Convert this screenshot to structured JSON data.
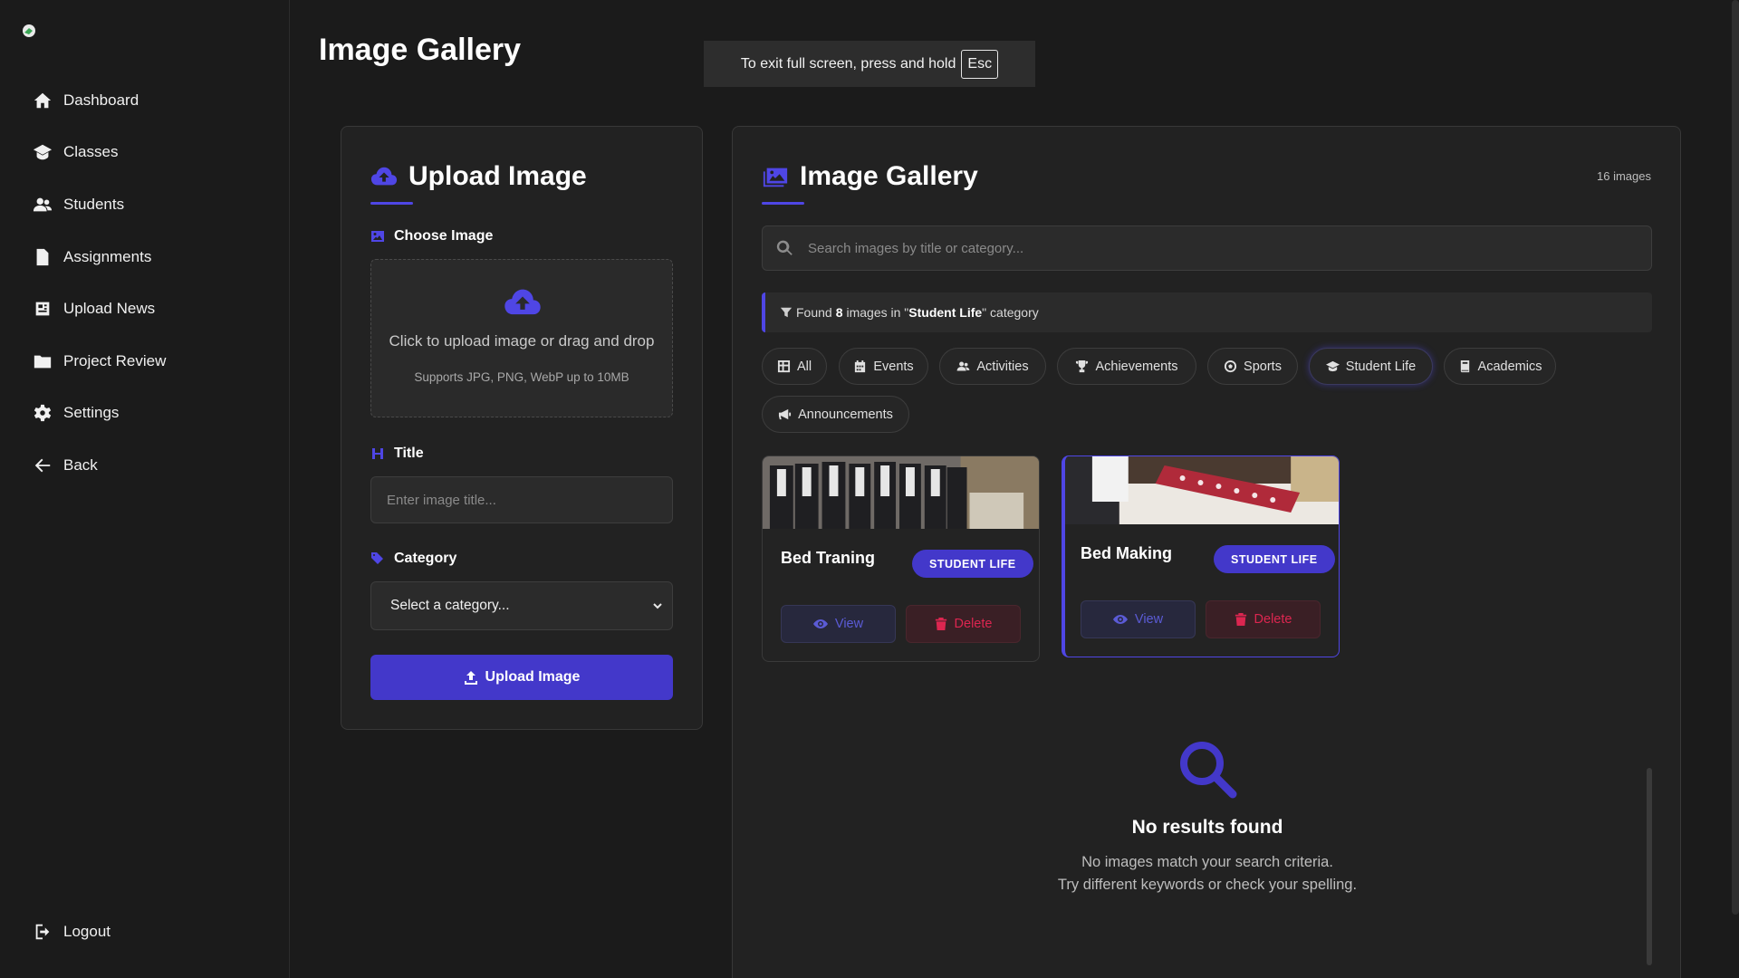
{
  "page": {
    "title": "Image Gallery"
  },
  "toast": {
    "text": "To exit full screen, press and hold",
    "key": "Esc"
  },
  "sidebar": {
    "items": [
      {
        "label": "Dashboard",
        "icon": "home-icon"
      },
      {
        "label": "Classes",
        "icon": "classroom-icon"
      },
      {
        "label": "Students",
        "icon": "users-icon"
      },
      {
        "label": "Assignments",
        "icon": "file-icon"
      },
      {
        "label": "Upload News",
        "icon": "newspaper-icon"
      },
      {
        "label": "Project Review",
        "icon": "folder-icon"
      },
      {
        "label": "Settings",
        "icon": "gear-icon"
      },
      {
        "label": "Back",
        "icon": "arrow-left-icon"
      }
    ],
    "logout": "Logout"
  },
  "upload": {
    "title": "Upload Image",
    "choose_label": "Choose Image",
    "dropzone_main": "Click to upload image or drag and drop",
    "dropzone_sub": "Supports JPG, PNG, WebP up to 10MB",
    "title_label": "Title",
    "title_placeholder": "Enter image title...",
    "category_label": "Category",
    "category_selected": "Select a category...",
    "submit": "Upload Image"
  },
  "gallery": {
    "title": "Image Gallery",
    "count": "16 images",
    "search_placeholder": "Search images by title or category...",
    "filter_prefix": "Found",
    "filter_count": "8",
    "filter_mid": "images in \"",
    "filter_category": "Student Life",
    "filter_suffix": "\" category",
    "chips": [
      {
        "label": "All",
        "icon": "grid-icon"
      },
      {
        "label": "Events",
        "icon": "calendar-icon"
      },
      {
        "label": "Activities",
        "icon": "users-icon"
      },
      {
        "label": "Achievements",
        "icon": "trophy-icon"
      },
      {
        "label": "Sports",
        "icon": "ball-icon"
      },
      {
        "label": "Student Life",
        "icon": "graduation-cap-icon",
        "active": true
      },
      {
        "label": "Academics",
        "icon": "book-icon"
      },
      {
        "label": "Announcements",
        "icon": "megaphone-icon"
      }
    ],
    "cards": [
      {
        "title": "Bed Traning",
        "badge": "STUDENT LIFE",
        "view": "View",
        "delete": "Delete"
      },
      {
        "title": "Bed Making",
        "badge": "STUDENT LIFE",
        "view": "View",
        "delete": "Delete"
      }
    ],
    "empty": {
      "title": "No results found",
      "line1": "No images match your search criteria.",
      "line2": "Try different keywords or check your spelling."
    }
  },
  "colors": {
    "accent": "#4f46e5",
    "danger": "#dc2650",
    "background": "#1b1b1b",
    "panel": "#222222"
  }
}
